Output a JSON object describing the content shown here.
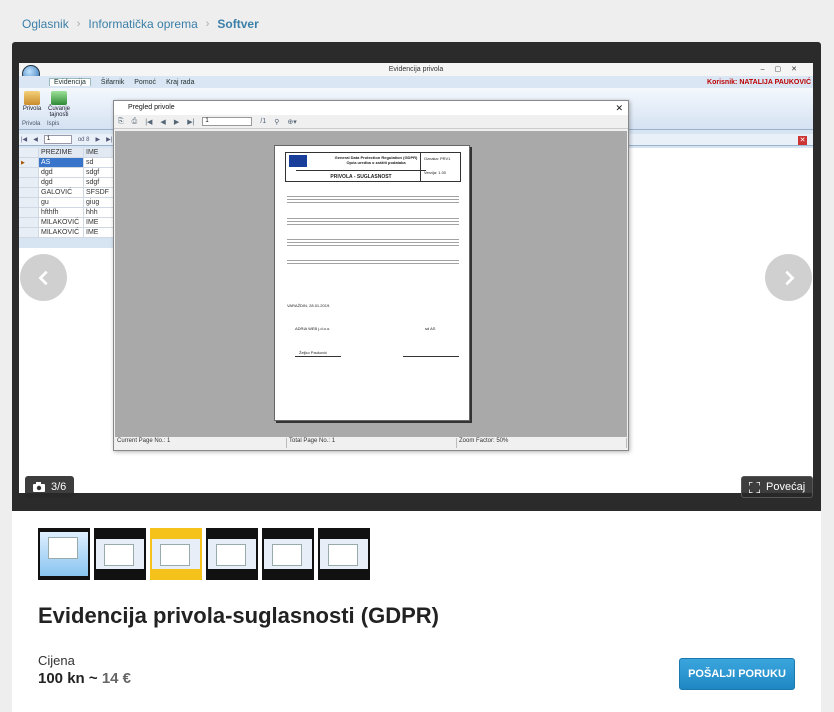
{
  "breadcrumb": {
    "items": [
      "Oglasnik",
      "Informatička oprema"
    ],
    "current": "Softver"
  },
  "gallery": {
    "counter": "3/6",
    "zoom_label": "Povećaj",
    "icons": {
      "prev": "chevron-left-icon",
      "next": "chevron-right-icon",
      "camera": "camera-icon",
      "expand": "expand-icon"
    }
  },
  "screenshot": {
    "window_title": "Evidencija privola",
    "ribbon_tabs": [
      "Evidencija",
      "Šifarnik",
      "Pomoć",
      "Kraj rada"
    ],
    "user_label": "Korisnik: NATALIJA PAUKOVIĆ",
    "ribbon_buttons": [
      "Privola",
      "Čuvanje tajnosti"
    ],
    "group_labels": [
      "Privola",
      "Ispis"
    ],
    "record_page": "1",
    "record_of": "od 8",
    "grid_headers": [
      "PREZIME",
      "IME"
    ],
    "grid_rows": [
      [
        "AS",
        "sd"
      ],
      [
        "dgd",
        "sdgf"
      ],
      [
        "dgd",
        "sdgf"
      ],
      [
        "GALOVIĆ",
        "SFSDF"
      ],
      [
        "gu",
        "giug"
      ],
      [
        "hfthfh",
        "hhh"
      ],
      [
        "MILAKOVIĆ",
        "IME"
      ],
      [
        "MILAKOVIĆ",
        "IME"
      ]
    ],
    "dialog_title": "Pregled privole",
    "dialog_page": "1",
    "dialog_of": "/1",
    "paper": {
      "header_line1": "General Data Protection Regulation (GDPR)",
      "header_line2": "Opća uredba o zaštiti podataka",
      "doc_title": "PRIVOLA - SUGLASNOST",
      "side_code": "Oznaka: PRV1",
      "side_version": "Verzija: 1.00",
      "place_date": "VARAŽDIN, 28.01.2019.",
      "left_sign": "ADRIA WEB j.d.o.o.",
      "right_sign": "sd AS",
      "signer": "Željko Pauković"
    },
    "status": {
      "page": "Current Page No.: 1",
      "total": "Total Page No.: 1",
      "zoom": "Zoom Factor: 50%"
    }
  },
  "listing": {
    "title": "Evidencija privola-suglasnosti (GDPR)",
    "price_label": "Cijena",
    "price_kn": "100 kn ~",
    "price_eur": "14 €",
    "message_button": "POŠALJI PORUKU"
  },
  "thumbnails": {
    "count": 6,
    "active_index": 2
  },
  "colors": {
    "accent": "#3b7fa8",
    "button": "#2596d1",
    "active_thumb": "#f4c21b"
  }
}
